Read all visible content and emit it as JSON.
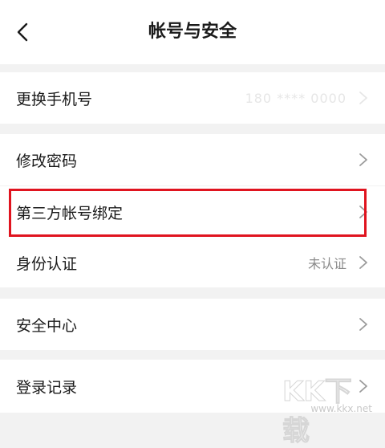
{
  "header": {
    "title": "帐号与安全",
    "back_icon": "chevron-left-icon"
  },
  "items": [
    {
      "label": "更换手机号",
      "value": "180 **** 0000",
      "chevron": "chevron-right-icon"
    },
    {
      "label": "修改密码",
      "value": "",
      "chevron": "chevron-right-icon"
    },
    {
      "label": "第三方帐号绑定",
      "value": "",
      "chevron": "chevron-right-icon"
    },
    {
      "label": "身份认证",
      "value": "未认证",
      "chevron": "chevron-right-icon"
    },
    {
      "label": "安全中心",
      "value": "",
      "chevron": "chevron-right-icon"
    },
    {
      "label": "登录记录",
      "value": "",
      "chevron": "chevron-right-icon"
    }
  ],
  "highlight_color": "#e0141f",
  "watermark": {
    "logo": "KK下载",
    "url": "www.kkx.net"
  }
}
